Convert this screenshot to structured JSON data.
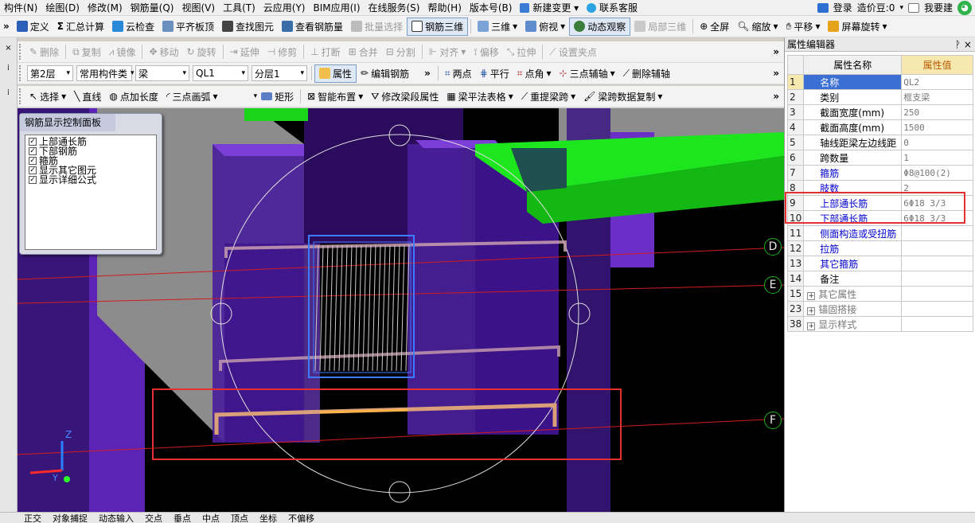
{
  "menu": {
    "items": [
      "构件(N)",
      "绘图(D)",
      "修改(M)",
      "钢筋量(Q)",
      "视图(V)",
      "工具(T)",
      "云应用(Y)",
      "BIM应用(I)",
      "在线服务(S)",
      "帮助(H)",
      "版本号(B)",
      "新建变更",
      "联系客服"
    ],
    "login": "登录",
    "beans": "造价豆:0",
    "want": "我要建"
  },
  "toolbar1": {
    "items": [
      "定义",
      "汇总计算",
      "云检查",
      "平齐板顶",
      "查找图元",
      "查看钢筋量",
      "批量选择",
      "钢筋三维",
      "三维",
      "俯视",
      "动态观察",
      "局部三维",
      "全屏",
      "缩放",
      "平移",
      "屏幕旋转"
    ]
  },
  "toolbar2": {
    "items": [
      "删除",
      "复制",
      "镜像",
      "移动",
      "旋转",
      "延伸",
      "修剪",
      "打断",
      "合并",
      "分割",
      "对齐",
      "偏移",
      "拉伸",
      "设置夹点"
    ]
  },
  "toolbar3": {
    "floor": "第2层",
    "category": "常用构件类",
    "type": "梁",
    "element": "QL1",
    "layer": "分层1",
    "properties": "属性",
    "edit_rebar": "编辑钢筋",
    "two_points": "两点",
    "parallel": "平行",
    "point_angle": "点角",
    "three_point_axis": "三点辅轴",
    "delete_axis": "删除辅轴"
  },
  "toolbar4": {
    "items": [
      "选择",
      "直线",
      "点加长度",
      "三点画弧",
      "矩形",
      "智能布置",
      "修改梁段属性",
      "梁平法表格",
      "重提梁跨",
      "梁跨数据复制"
    ]
  },
  "rebar_panel": {
    "title": "钢筋显示控制面板",
    "options": [
      {
        "label": "上部通长筋",
        "checked": true
      },
      {
        "label": "下部钢筋",
        "checked": true
      },
      {
        "label": "箍筋",
        "checked": true
      },
      {
        "label": "显示其它图元",
        "checked": true
      },
      {
        "label": "显示详细公式",
        "checked": true
      }
    ]
  },
  "viewport": {
    "axis_labels": [
      "D",
      "E",
      "F"
    ],
    "axis_z": "Z",
    "axis_y": "Y"
  },
  "property_editor": {
    "title": "属性编辑器",
    "pin": "ᚹ ×",
    "header_name": "属性名称",
    "header_value": "属性值",
    "rows": [
      {
        "num": "1",
        "name": "名称",
        "value": "QL2",
        "style": "sel"
      },
      {
        "num": "2",
        "name": "类别",
        "value": "框支梁",
        "style": ""
      },
      {
        "num": "3",
        "name": "截面宽度(mm)",
        "value": "250",
        "style": ""
      },
      {
        "num": "4",
        "name": "截面高度(mm)",
        "value": "1500",
        "style": ""
      },
      {
        "num": "5",
        "name": "轴线距梁左边线距",
        "value": "0",
        "style": ""
      },
      {
        "num": "6",
        "name": "跨数量",
        "value": "1",
        "style": ""
      },
      {
        "num": "7",
        "name": "箍筋",
        "value": "Φ8@100(2)",
        "style": "blue"
      },
      {
        "num": "8",
        "name": "肢数",
        "value": "2",
        "style": "blue"
      },
      {
        "num": "9",
        "name": "上部通长筋",
        "value": "6Φ18 3/3",
        "style": "blue"
      },
      {
        "num": "10",
        "name": "下部通长筋",
        "value": "6Φ18 3/3",
        "style": "blue"
      },
      {
        "num": "11",
        "name": "侧面构造或受扭筋",
        "value": "",
        "style": "blue"
      },
      {
        "num": "12",
        "name": "拉筋",
        "value": "",
        "style": "blue"
      },
      {
        "num": "13",
        "name": "其它箍筋",
        "value": "",
        "style": "blue"
      },
      {
        "num": "14",
        "name": "备注",
        "value": "",
        "style": ""
      },
      {
        "num": "15",
        "name": "其它属性",
        "value": "",
        "style": "grey"
      },
      {
        "num": "23",
        "name": "锚固搭接",
        "value": "",
        "style": "grey"
      },
      {
        "num": "38",
        "name": "显示样式",
        "value": "",
        "style": "grey"
      }
    ]
  },
  "statusbar": {
    "items": [
      "正交",
      "对象捕捉",
      "动态输入",
      "交点",
      "垂点",
      "中点",
      "顶点",
      "坐标",
      "不偏移"
    ]
  },
  "colors": {
    "wall_purple": "#4a1a9a",
    "column_violet": "#6b2fc7",
    "beam_green": "#19d419",
    "highlight_red": "#e5302f",
    "selection_blue": "#2f6fff"
  }
}
